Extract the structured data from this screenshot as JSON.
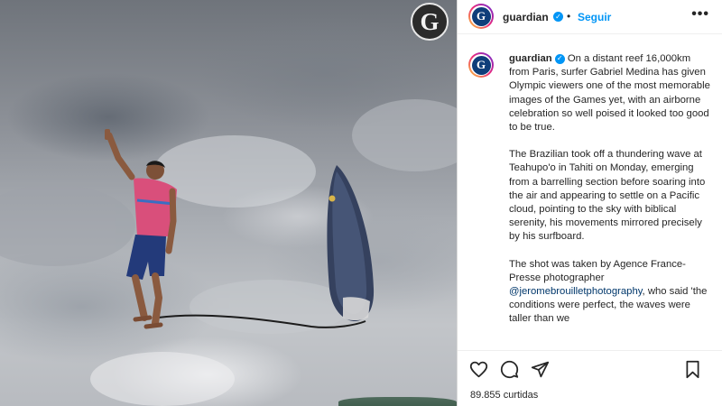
{
  "post": {
    "author": "guardian",
    "follow_label": "Seguir",
    "separator": "•",
    "brand_letter": "G",
    "avatar_letter": "G",
    "caption_paragraphs": [
      "On a distant reef 16,000km from Paris, surfer Gabriel Medina has given Olympic viewers one of the most memorable images of the Games yet, with an airborne celebration so well poised it looked too good to be true.",
      "The Brazilian took off a thundering wave at Teahupo'o in Tahiti on Monday, emerging from a barrelling section before soaring into the air and appearing to settle on a Pacific cloud, pointing to the sky with biblical serenity, his movements mirrored precisely by his surfboard."
    ],
    "caption_third_start": "The shot was taken by Agence France-Presse photographer ",
    "caption_mention": "@jeromebrouilletphotography",
    "caption_third_end": ", who said 'the conditions were perfect, the waves were taller than we",
    "likes": "89.855 curtidas"
  },
  "icons": {
    "verified": "verified-badge-icon",
    "more": "more-options-icon",
    "like": "heart-icon",
    "comment": "comment-icon",
    "share": "paper-plane-icon",
    "save": "bookmark-icon"
  },
  "colors": {
    "accent": "#0095f6",
    "link": "#00376b",
    "text": "#262626"
  }
}
